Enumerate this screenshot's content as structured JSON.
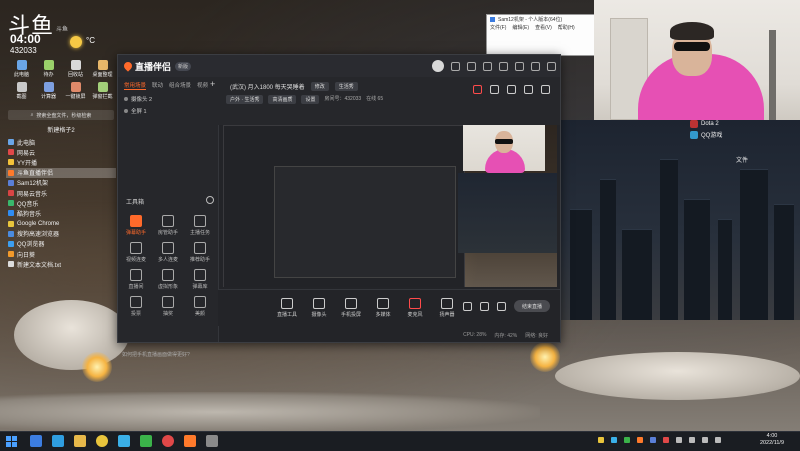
{
  "overlay": {
    "logo": "斗鱼",
    "logo_sub": "斗鱼",
    "clock": "04:00",
    "date": "432033",
    "weather_temp": "°C"
  },
  "desktop_icons": [
    {
      "label": "此电脑",
      "color": "#6aa6e8"
    },
    {
      "label": "待办",
      "color": "#9ad06a"
    },
    {
      "label": "回收站",
      "color": "#d9d9d9"
    },
    {
      "label": "桌面整理",
      "color": "#e8b76a"
    },
    {
      "label": "截图",
      "color": "#c9c9c9"
    },
    {
      "label": "计算器",
      "color": "#7d9fe0"
    },
    {
      "label": "一键锁屏",
      "color": "#e08a6a"
    },
    {
      "label": "弹窗拦截",
      "color": "#a3d07a"
    }
  ],
  "group_label": "新建格子2",
  "search_placeholder": "搜索全盘文件，秒级检索",
  "apps": [
    {
      "label": "此电脑",
      "color": "#6aa6e8"
    },
    {
      "label": "网易云",
      "color": "#e04848"
    },
    {
      "label": "YY开播",
      "color": "#f3c23a"
    },
    {
      "label": "斗鱼直播伴侣",
      "color": "#ff7a2b",
      "selected": true
    },
    {
      "label": "Sam12机架",
      "color": "#5a7fd8"
    },
    {
      "label": "网易云音乐",
      "color": "#d84444"
    },
    {
      "label": "QQ音乐",
      "color": "#39b86c"
    },
    {
      "label": "酷狗音乐",
      "color": "#2f8cf2"
    },
    {
      "label": "Google Chrome",
      "color": "#e9c53c"
    },
    {
      "label": "搜狗高速浏览器",
      "color": "#4a8be0"
    },
    {
      "label": "QQ浏览器",
      "color": "#3c9ef0"
    },
    {
      "label": "向日葵",
      "color": "#f39a2b"
    },
    {
      "label": "新建文本文档.txt",
      "color": "#dddddd"
    }
  ],
  "window": {
    "brand": "直播伴侣",
    "brand_badge": "新版",
    "left_tabs": [
      "常用场景",
      "联动",
      "组合场景",
      "视频"
    ],
    "scenes": [
      "摄像头 2",
      "全屏 1"
    ],
    "tools_title": "工具箱",
    "tools": [
      {
        "label": "弹幕助手",
        "hot": true
      },
      {
        "label": "房管助手",
        "hot": false
      },
      {
        "label": "主播任务",
        "hot": false
      },
      {
        "label": "视频连麦",
        "hot": false
      },
      {
        "label": "多人连麦",
        "hot": false
      },
      {
        "label": "推荐助手",
        "hot": false
      },
      {
        "label": "直播间",
        "hot": false
      },
      {
        "label": "虚拟形象",
        "hot": false
      },
      {
        "label": "弹幕库",
        "hot": false
      },
      {
        "label": "投票",
        "hot": false
      },
      {
        "label": "抽奖",
        "hot": false
      },
      {
        "label": "美颜",
        "hot": false
      }
    ],
    "ad": "如何把手机直播画面做得更好?",
    "room_title": "(武汉) 月入1800 每天哭睡着",
    "room_chip1": "修改",
    "room_chip2": "生活秀",
    "room_row": [
      "户外 · 生活秀",
      "高清画质",
      "设置",
      "房间号：432033",
      "在线 65"
    ],
    "controls": [
      "直播工具",
      "摄像头",
      "手机投屏",
      "多媒体",
      "麦克风",
      "扬声器"
    ],
    "go_live": "结束直播",
    "status": [
      "CPU: 28%",
      "内存: 42%",
      "网络: 良好"
    ]
  },
  "mini_browser": {
    "title": "Sam12机架 - 个人版本(64位)",
    "menu": [
      "文件(F)",
      "编辑(E)",
      "查看(V)",
      "帮助(H)"
    ]
  },
  "desktop_right": [
    {
      "label": "Dota 2",
      "color": "#b33"
    },
    {
      "label": "QQ游戏",
      "color": "#39c"
    },
    {
      "label": "文件",
      "color": "#ccc"
    }
  ],
  "taskbar": {
    "apps": [
      {
        "name": "windows-search",
        "color": "#3c7de0"
      },
      {
        "name": "edge",
        "color": "#2f9ee0"
      },
      {
        "name": "explorer",
        "color": "#e6b84a"
      },
      {
        "name": "chrome",
        "color": "#e9c53c"
      },
      {
        "name": "qq",
        "color": "#3ab0e8"
      },
      {
        "name": "wechat",
        "color": "#3bb34a"
      },
      {
        "name": "netease",
        "color": "#e04848"
      },
      {
        "name": "douyu",
        "color": "#ff7a2b"
      },
      {
        "name": "camera",
        "color": "#8a8a8a"
      }
    ],
    "time": "4:00",
    "date": "2022/11/9"
  }
}
